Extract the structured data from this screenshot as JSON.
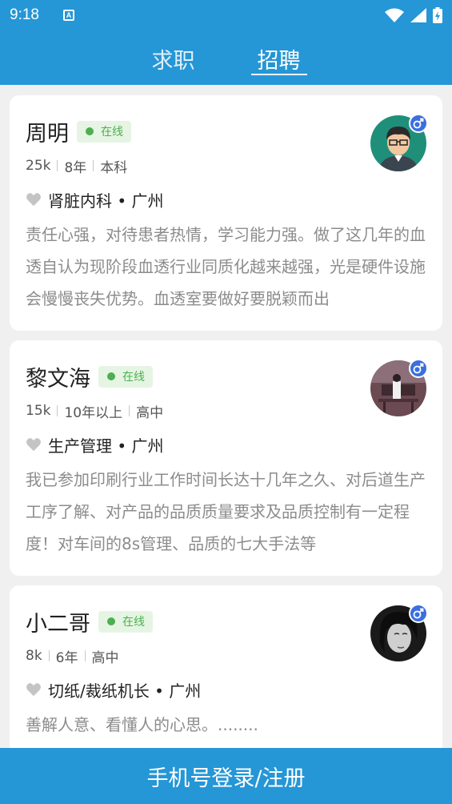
{
  "status_bar": {
    "time": "9:18",
    "notification_icon": "A"
  },
  "tabs": [
    {
      "label": "求职",
      "active": false
    },
    {
      "label": "招聘",
      "active": true
    }
  ],
  "candidates": [
    {
      "name": "周明",
      "status": "在线",
      "salary": "25k",
      "experience": "8年",
      "education": "本科",
      "job": "肾脏内科 • 广州",
      "description": "责任心强，对待患者热情，学习能力强。做了这几年的血透自认为现阶段血透行业同质化越来越强，光是硬件设施会慢慢丧失优势。血透室要做好要脱颖而出",
      "gender": "male"
    },
    {
      "name": "黎文海",
      "status": "在线",
      "salary": "15k",
      "experience": "10年以上",
      "education": "高中",
      "job": "生产管理 • 广州",
      "description": "我已参加印刷行业工作时间长达十几年之久、对后道生产工序了解、对产品的品质质量要求及品质控制有一定程度！对车间的8s管理、品质的七大手法等",
      "gender": "male"
    },
    {
      "name": "小二哥",
      "status": "在线",
      "salary": "8k",
      "experience": "6年",
      "education": "高中",
      "job": "切纸/裁纸机长 • 广州",
      "description": "善解人意、看懂人的心思。........",
      "gender": "male"
    }
  ],
  "footer": {
    "label": "手机号登录/注册"
  },
  "colors": {
    "primary": "#2596d6",
    "online": "#4caf50",
    "gender": "#3b6fe0"
  }
}
